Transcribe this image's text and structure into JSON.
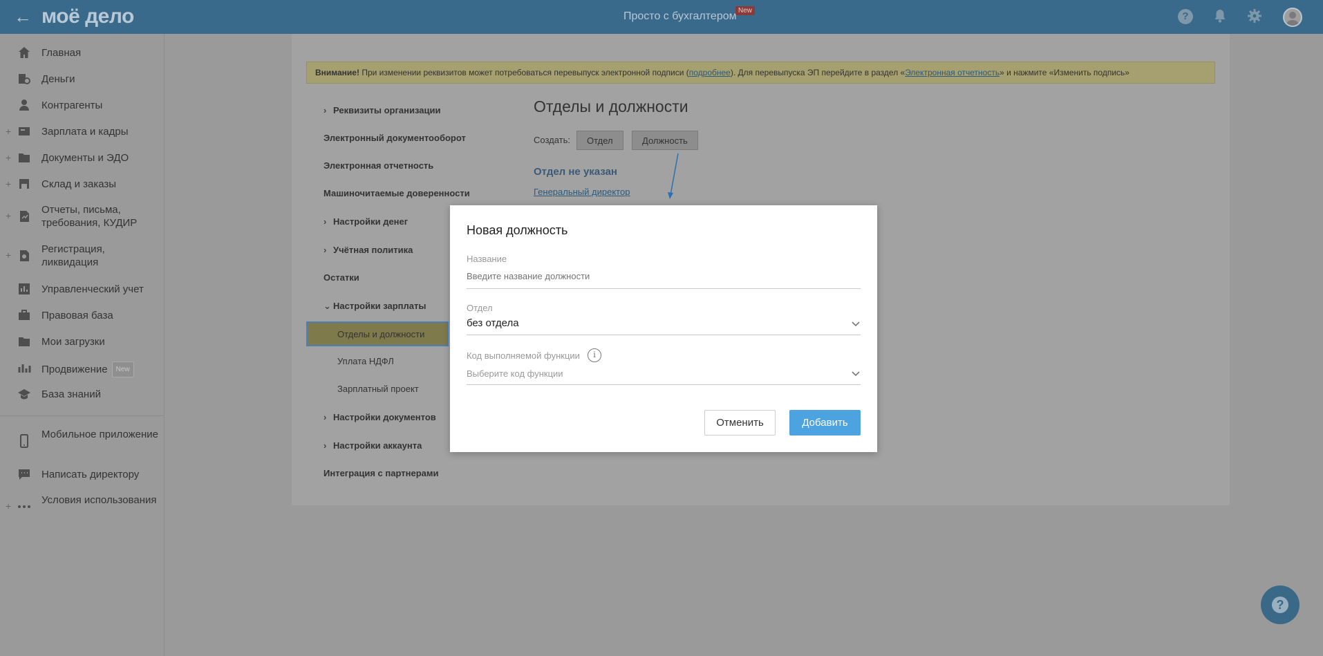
{
  "header": {
    "back_symbol": "←",
    "logo": "моё дело",
    "title": "Просто с бухгалтером",
    "title_badge": "New",
    "help_symbol": "?"
  },
  "sidebar": {
    "items": [
      {
        "label": "Главная",
        "icon": "home-icon"
      },
      {
        "label": "Деньги",
        "icon": "money-icon"
      },
      {
        "label": "Контрагенты",
        "icon": "contractors-icon"
      },
      {
        "label": "Зарплата и кадры",
        "icon": "salary-icon",
        "expandable": true
      },
      {
        "label": "Документы и ЭДО",
        "icon": "folder-icon",
        "expandable": true
      },
      {
        "label": "Склад и заказы",
        "icon": "warehouse-icon",
        "expandable": true
      },
      {
        "label": "Отчеты, письма, требования, КУДИР",
        "icon": "reports-icon",
        "expandable": true
      },
      {
        "label": "Регистрация, ликвидация",
        "icon": "registration-icon",
        "expandable": true
      },
      {
        "label": "Управленческий учет",
        "icon": "management-icon"
      },
      {
        "label": "Правовая база",
        "icon": "briefcase-icon"
      },
      {
        "label": "Мои загрузки",
        "icon": "folder-icon"
      },
      {
        "label": "Продвижение",
        "icon": "chart-icon",
        "badge": "New"
      },
      {
        "label": "База знаний",
        "icon": "graduation-cap-icon"
      },
      {
        "label": "Мобильное приложение",
        "icon": "phone-icon"
      },
      {
        "label": "Написать директору",
        "icon": "message-icon"
      },
      {
        "label": "Условия использования",
        "icon": "more-icon",
        "expandable": true
      }
    ]
  },
  "warning": {
    "bold": "Внимание!",
    "text1": " При изменении реквизитов может потребоваться перевыпуск электронной подписи (",
    "link1": "подробнее",
    "text2": "). Для перевыпуска ЭП перейдите в раздел «",
    "link2": "Электронная отчетность",
    "text3": "» и нажмите «Изменить подпись»"
  },
  "settings_nav": {
    "items": [
      {
        "label": "Реквизиты организации",
        "chevron": "›"
      },
      {
        "label": "Электронный документооборот"
      },
      {
        "label": "Электронная отчетность"
      },
      {
        "label": "Машиночитаемые доверенности"
      },
      {
        "label": "Настройки денег",
        "chevron": "›"
      },
      {
        "label": "Учётная политика",
        "chevron": "›"
      },
      {
        "label": "Остатки"
      },
      {
        "label": "Настройки зарплаты",
        "chevron": "⌄"
      },
      {
        "label": "Настройки документов",
        "chevron": "›"
      },
      {
        "label": "Настройки аккаунта",
        "chevron": "›"
      },
      {
        "label": "Интеграция с партнерами"
      }
    ],
    "salary_sub": [
      "Отделы и должности",
      "Уплата НДФЛ",
      "Зарплатный проект"
    ]
  },
  "main": {
    "title": "Отделы и должности",
    "create_label": "Создать:",
    "create_department": "Отдел",
    "create_position": "Должность",
    "department_title": "Отдел не указан",
    "position_link": "Генеральный директор"
  },
  "modal": {
    "title": "Новая должность",
    "name_label": "Название",
    "name_placeholder": "Введите название должности",
    "dept_label": "Отдел",
    "dept_value": "без отдела",
    "func_label": "Код выполняемой функции",
    "info_symbol": "i",
    "func_placeholder": "Выберите код функции",
    "cancel": "Отменить",
    "add": "Добавить"
  },
  "help_fab_symbol": "?"
}
